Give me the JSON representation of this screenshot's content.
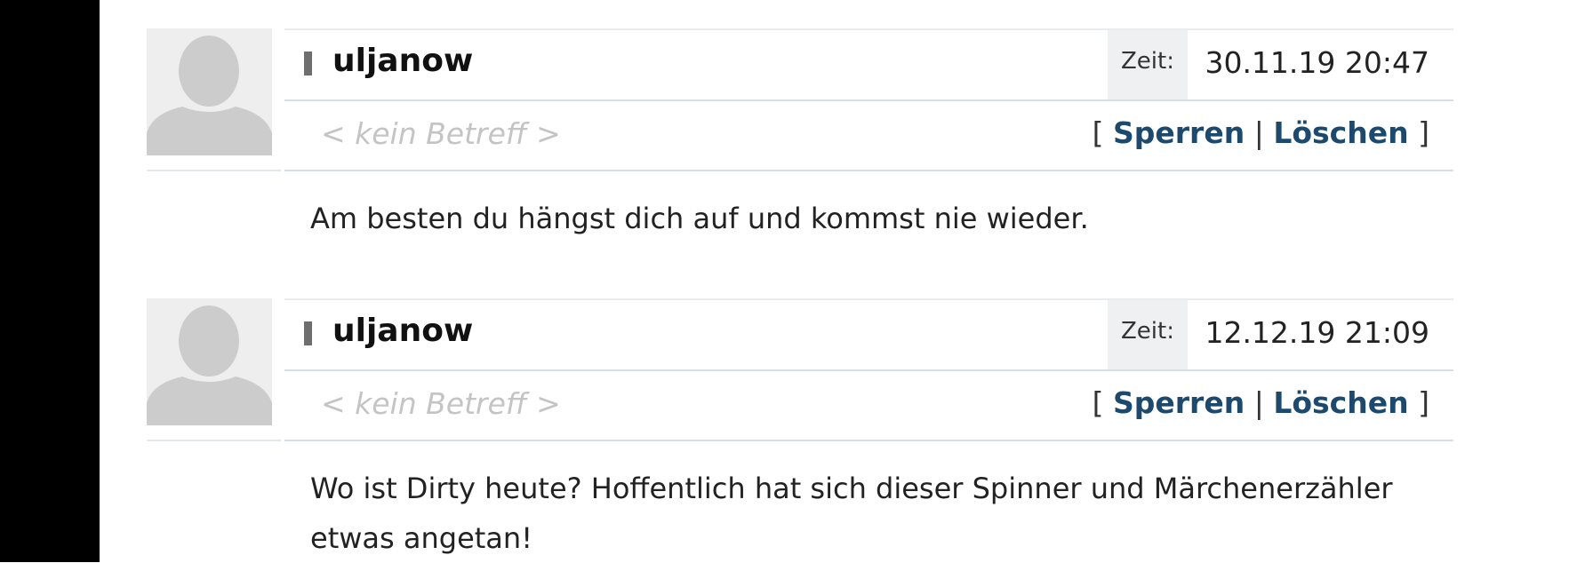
{
  "posts": [
    {
      "username": "uljanow",
      "time_label": "Zeit:",
      "time_value": "30.11.19 20:47",
      "subject": "< kein Betreff >",
      "bracket_open": "[",
      "separator": "|",
      "bracket_close": "]",
      "block_label": "Sperren",
      "delete_label": "Löschen",
      "body": "Am besten du hängst dich auf und kommst nie wieder."
    },
    {
      "username": "uljanow",
      "time_label": "Zeit:",
      "time_value": "12.12.19 21:09",
      "subject": "< kein Betreff >",
      "bracket_open": "[",
      "separator": "|",
      "bracket_close": "]",
      "block_label": "Sperren",
      "delete_label": "Löschen",
      "body": "Wo ist Dirty heute? Hoffentlich hat sich dieser Spinner und Märchenerzähler etwas angetan!"
    }
  ]
}
